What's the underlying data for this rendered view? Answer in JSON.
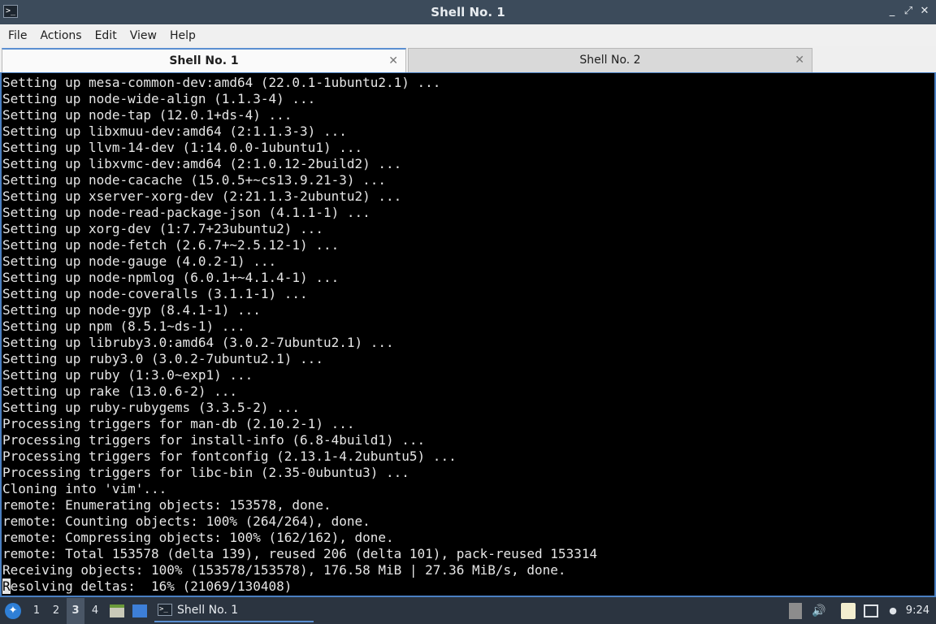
{
  "window": {
    "title": "Shell No. 1",
    "app_icon": "terminal-icon",
    "buttons": {
      "minimize": "_",
      "maximize": "⤢",
      "close": "✕"
    }
  },
  "menu": [
    "File",
    "Actions",
    "Edit",
    "View",
    "Help"
  ],
  "tabs": [
    {
      "label": "Shell No. 1",
      "active": true
    },
    {
      "label": "Shell No. 2",
      "active": false
    }
  ],
  "tab_close_glyph": "✕",
  "terminal": {
    "lines": [
      "Setting up mesa-common-dev:amd64 (22.0.1-1ubuntu2.1) ...",
      "Setting up node-wide-align (1.1.3-4) ...",
      "Setting up node-tap (12.0.1+ds-4) ...",
      "Setting up libxmuu-dev:amd64 (2:1.1.3-3) ...",
      "Setting up llvm-14-dev (1:14.0.0-1ubuntu1) ...",
      "Setting up libxvmc-dev:amd64 (2:1.0.12-2build2) ...",
      "Setting up node-cacache (15.0.5+~cs13.9.21-3) ...",
      "Setting up xserver-xorg-dev (2:21.1.3-2ubuntu2) ...",
      "Setting up node-read-package-json (4.1.1-1) ...",
      "Setting up xorg-dev (1:7.7+23ubuntu2) ...",
      "Setting up node-fetch (2.6.7+~2.5.12-1) ...",
      "Setting up node-gauge (4.0.2-1) ...",
      "Setting up node-npmlog (6.0.1+~4.1.4-1) ...",
      "Setting up node-coveralls (3.1.1-1) ...",
      "Setting up node-gyp (8.4.1-1) ...",
      "Setting up npm (8.5.1~ds-1) ...",
      "Setting up libruby3.0:amd64 (3.0.2-7ubuntu2.1) ...",
      "Setting up ruby3.0 (3.0.2-7ubuntu2.1) ...",
      "Setting up ruby (1:3.0~exp1) ...",
      "Setting up rake (13.0.6-2) ...",
      "Setting up ruby-rubygems (3.3.5-2) ...",
      "Processing triggers for man-db (2.10.2-1) ...",
      "Processing triggers for install-info (6.8-4build1) ...",
      "Processing triggers for fontconfig (2.13.1-4.2ubuntu5) ...",
      "Processing triggers for libc-bin (2.35-0ubuntu3) ...",
      "Cloning into 'vim'...",
      "remote: Enumerating objects: 153578, done.",
      "remote: Counting objects: 100% (264/264), done.",
      "remote: Compressing objects: 100% (162/162), done.",
      "remote: Total 153578 (delta 139), reused 206 (delta 101), pack-reused 153314",
      "Receiving objects: 100% (153578/153578), 176.58 MiB | 27.36 MiB/s, done."
    ],
    "cursor_char": "R",
    "last_line_rest": "esolving deltas:  16% (21069/130408)"
  },
  "taskbar": {
    "start_icon": "start-menu-icon",
    "desktops": [
      "1",
      "2",
      "3",
      "4"
    ],
    "active_desktop": "3",
    "task_label": "Shell No. 1",
    "tray_icons": [
      "notes-icon",
      "volume-icon",
      "clipboard-icon",
      "network-icon"
    ],
    "clock": "9:24"
  },
  "colors": {
    "titlebar": "#3c4b5b",
    "terminal_bg": "#000000",
    "terminal_fg": "#e6e6e6",
    "accent": "#4a7fc1",
    "taskbar": "#2b3440"
  }
}
